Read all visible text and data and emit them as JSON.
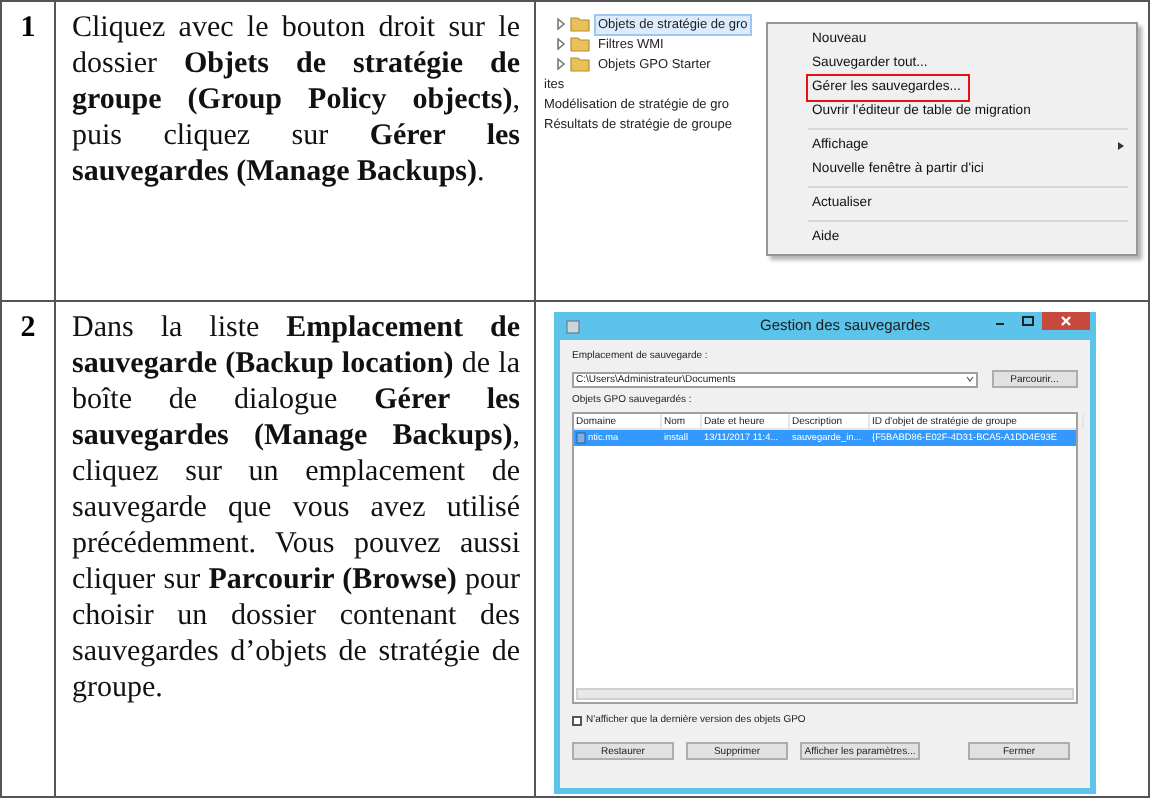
{
  "steps": [
    {
      "number": "1",
      "text": "Cliquez avec le bouton droit sur le dossier **Objets de stratégie de groupe (Group Policy objects)**, puis cliquez sur **Gérer les sauvegardes (Manage Backups)**.",
      "screenshot": {
        "kind": "context_menu",
        "tree_items": [
          {
            "label": "Objets de stratégie de gro",
            "kind": "folder",
            "selected": true
          },
          {
            "label": "Filtres WMI",
            "kind": "folder",
            "selected": false
          },
          {
            "label": "Objets GPO Starter",
            "kind": "folder",
            "selected": false
          },
          {
            "label": "ites",
            "kind": "plain",
            "selected": false
          },
          {
            "label": "Modélisation de stratégie de gro",
            "kind": "plain",
            "selected": false
          },
          {
            "label": "Résultats de stratégie de groupe",
            "kind": "plain",
            "selected": false
          }
        ],
        "menu_items": [
          {
            "label": "Nouveau",
            "separator_before": false,
            "highlighted": false,
            "submenu": false
          },
          {
            "label": "Sauvegarder tout...",
            "separator_before": false,
            "highlighted": false,
            "submenu": false
          },
          {
            "label": "Gérer les sauvegardes...",
            "separator_before": false,
            "highlighted": true,
            "submenu": false
          },
          {
            "label": "Ouvrir l'éditeur de table de migration",
            "separator_before": false,
            "highlighted": false,
            "submenu": false
          },
          {
            "label": "Affichage",
            "separator_before": true,
            "highlighted": false,
            "submenu": true
          },
          {
            "label": "Nouvelle fenêtre à partir d'ici",
            "separator_before": false,
            "highlighted": false,
            "submenu": false
          },
          {
            "label": "Actualiser",
            "separator_before": true,
            "highlighted": false,
            "submenu": false
          },
          {
            "label": "Aide",
            "separator_before": true,
            "highlighted": false,
            "submenu": false
          }
        ]
      }
    },
    {
      "number": "2",
      "text": "Dans la liste **Emplacement de sauvegarde (Backup location)** de la boîte de dialogue **Gérer les sauvegardes (Manage Backups)**, cliquez sur un emplacement de sauvegarde que vous avez utilisé précédemment. Vous pouvez aussi cliquer sur **Parcourir (Browse)** pour choisir un dossier contenant des sauvegardes d’objets de stratégie de groupe.",
      "screenshot": {
        "kind": "dialog",
        "title": "Gestion des sauvegardes",
        "location_label": "Emplacement de sauvegarde :",
        "location_value": "C:\\Users\\Administrateur\\Documents",
        "browse_button": "Parcourir...",
        "list_label": "Objets GPO sauvegardés :",
        "columns": [
          "Domaine",
          "Nom",
          "Date et heure",
          "Description",
          "ID d'objet de stratégie de groupe"
        ],
        "rows": [
          {
            "cells": [
              "ntic.ma",
              "install",
              "13/11/2017 11:4...",
              "sauvegarde_in...",
              "{F5BABD86-E02F-4D31-BCA5-A1DD4E93E"
            ],
            "selected": true
          }
        ],
        "checkbox": {
          "label": "N'afficher que la dernière version des objets GPO",
          "checked": false
        },
        "buttons": [
          "Restaurer",
          "Supprimer",
          "Afficher les paramètres...",
          "Fermer"
        ]
      }
    }
  ]
}
